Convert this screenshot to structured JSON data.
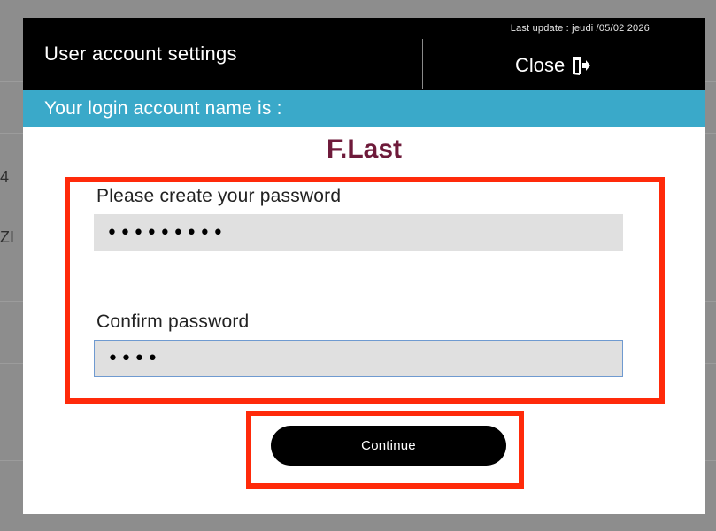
{
  "background": {
    "fragments": [
      "4",
      "ZI"
    ]
  },
  "modal": {
    "title": "User account settings",
    "last_update": "Last update : jeudi /05/02 2026",
    "close_label": "Close",
    "account_prompt": "Your login account name is :",
    "username": "F.Last"
  },
  "form": {
    "password_label": "Please create your password",
    "password_value": "•••••••••",
    "confirm_label": "Confirm password",
    "confirm_value": "••••",
    "continue_label": "Continue"
  },
  "colors": {
    "header_bg": "#000000",
    "account_bar": "#3aa9c9",
    "username_color": "#6e1a3a",
    "highlight": "#ff2a0a",
    "input_bg": "#e0e0e0"
  },
  "icons": {
    "close": "door-exit-icon"
  }
}
